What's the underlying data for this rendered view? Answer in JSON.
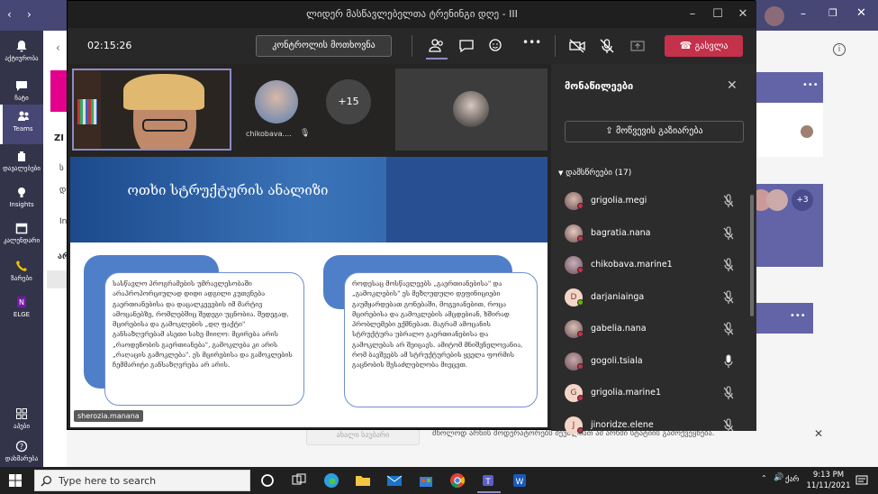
{
  "meeting": {
    "title": "ლიდერ მასწავლებელთა ტრენინგი დღე - III",
    "elapsed": "02:15:26",
    "request_control_label": "კონტროლის მოთხოვნა",
    "leave_label": "გასვლა"
  },
  "video_strip": {
    "tile2_name": "chikobava....",
    "overflow_count": "+15"
  },
  "slide": {
    "title": "ოთხი სტრუქტურის ანალიზი",
    "left_text": "სასწავლო პროგრამების უმრავლესობაში არაპროპორციულად დიდი ადგილი კუთვნება გაერთიანებისა და დაცალკევების იმ მარტივ ამოცანებზე, რომლებშიც შედეგი უცნობია. შედეგად, მცირებისა და გამოკლების „დღ ფაქტი\" განსაზღვრებამ ასეთი სახე მიიღო: მცირება არის „რაოდენობის გაერთიანება\", გამოკლება კი არის „რაღაცის გამოკლება\". ეს მცირებისა და გამოკლების ჩემმარიტი განსაზღვრება არ არის.",
    "right_text": "როდესაც მოსწავლეებს „გაერთიანებისა\" და „გამოკლების\" ეს მეზღუდული დეფინიციები გაუმყარდებათ გონებაში, მოგვიანებით, როცა მცირებისა და გამოკლების ამცდებიან, ხშირად პრობლემები ექმნებათ. მაგრამ ამოცანის სტრუქტურა უბრალო გაერთიანებისა და გამოკლებას არ შეიცავს. ამიტომ მნიშვნელოვანია, რომ ბავშვებს ამ სტრუქტურების ყველა ფორმის გაცნობის შესაძლებლობა მიეცეთ.",
    "presenter_name": "sherozia.manana"
  },
  "panel": {
    "title": "მონაწილეები",
    "share_invite_label": "მოწვევის გაზიარება",
    "attendees_label": "დამსწრეები (17)",
    "participants": [
      {
        "name": "grigolia.megi",
        "mic": "muted",
        "status": "#c4314b",
        "initial": ""
      },
      {
        "name": "bagratia.nana",
        "mic": "muted",
        "status": "#c4314b",
        "initial": ""
      },
      {
        "name": "chikobava.marine1",
        "mic": "muted",
        "status": "#c4314b",
        "initial": ""
      },
      {
        "name": "darjaniainga",
        "mic": "muted",
        "status": "#6bb700",
        "initial": "D"
      },
      {
        "name": "gabelia.nana",
        "mic": "muted",
        "status": "#c4314b",
        "initial": ""
      },
      {
        "name": "gogoli.tsiala",
        "mic": "on",
        "status": "#c4314b",
        "initial": ""
      },
      {
        "name": "grigolia.marine1",
        "mic": "muted",
        "status": "#c4314b",
        "initial": "G"
      },
      {
        "name": "jinoridze.elene",
        "mic": "muted",
        "status": "#c4314b",
        "initial": "J"
      }
    ]
  },
  "teams": {
    "rail": [
      "აქტიურობა",
      "ჩატი",
      "Teams",
      "დავალებები",
      "Insights",
      "კალენდარი",
      "ზარები",
      "ELGE"
    ],
    "apps_label": "აპები",
    "help_label": "დახმარება",
    "overflow_badge": "+3",
    "bg_letters": [
      "ZI",
      "ს",
      "დ",
      "In",
      "არ"
    ],
    "background_button": "ახალი საუბარი",
    "notification": "მხოლოდ არხის მოდერატორებს შეუძლიათ ამ არხში სტატიის გამოქვეყნება."
  },
  "taskbar": {
    "search_placeholder": "Type here to search",
    "time": "9:13 PM",
    "date": "11/11/2021",
    "lang": "ქარ"
  },
  "colors": {
    "accent": "#6264a7",
    "leave": "#c4314b",
    "teams_rail": "#33344a"
  }
}
